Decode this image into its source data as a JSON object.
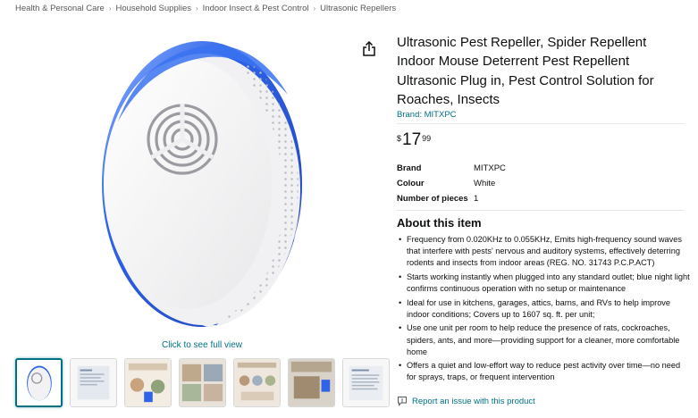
{
  "breadcrumb": [
    {
      "label": "Health & Personal Care"
    },
    {
      "label": "Household Supplies"
    },
    {
      "label": "Indoor Insect & Pest Control"
    },
    {
      "label": "Ultrasonic Repellers"
    }
  ],
  "breadcrumb_separator": "›",
  "gallery": {
    "see_full_view": "Click to see full view",
    "thumbnails": 7,
    "active_index": 0
  },
  "product": {
    "title": "Ultrasonic Pest Repeller, Spider Repellent Indoor Mouse Deterrent Pest Repellent Ultrasonic Plug in, Pest Control Solution for Roaches, Insects",
    "brand_link": "Brand: MITXPC",
    "price": {
      "symbol": "$",
      "whole": "17",
      "fraction": "99"
    },
    "specs": [
      {
        "key": "Brand",
        "value": "MITXPC"
      },
      {
        "key": "Colour",
        "value": "White"
      },
      {
        "key": "Number of pieces",
        "value": "1"
      }
    ],
    "about_heading": "About this item",
    "bullets": [
      "Frequency from 0.020KHz to 0.055KHz, Emits high-frequency sound waves that interfere with pests' nervous and auditory systems, effectively deterring rodents and insects from indoor areas (REG. NO. 31743 P.C.P.ACT)",
      "Starts working instantly when plugged into any standard outlet; blue night light confirms continuous operation with no setup or maintenance",
      "Ideal for use in kitchens, garages, attics, barns, and RVs to help improve indoor conditions; Covers up to 1607 sq. ft. per unit;",
      "Use one unit per room to help reduce the presence of rats, cockroaches, spiders, ants, and more—providing support for a cleaner, more comfortable home",
      "Offers a quiet and low-effort way to reduce pest activity over time—no need for sprays, traps, or frequent intervention"
    ],
    "report_link": "Report an issue with this product"
  },
  "colors": {
    "link": "#007185",
    "text": "#0f1111",
    "muted": "#565959",
    "accent_blue": "#2f63e8"
  },
  "icons": [
    "share-icon",
    "report-icon"
  ]
}
